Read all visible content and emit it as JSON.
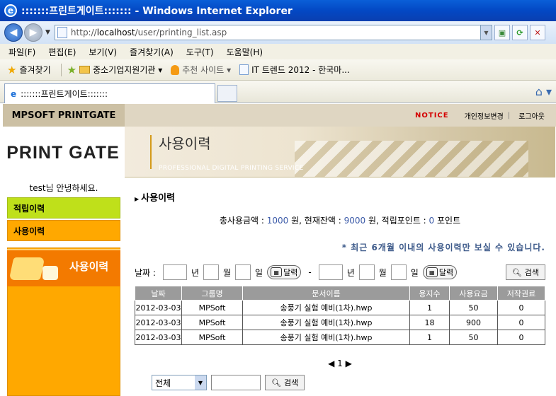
{
  "window": {
    "title": ":::::::프린트게이트::::::: - Windows Internet Explorer"
  },
  "address": {
    "prefix": "http://",
    "host": "localhost",
    "path": "/user/printing_list.asp"
  },
  "menu": [
    "파일(F)",
    "편집(E)",
    "보기(V)",
    "즐겨찾기(A)",
    "도구(T)",
    "도움말(H)"
  ],
  "favorites": {
    "label": "즐겨찾기",
    "items": [
      "중소기업지원기관 ▾",
      "추천 사이트 ▾",
      "IT 트렌드 2012 - 한국마..."
    ]
  },
  "tab": {
    "title": ":::::::프린트게이트:::::::"
  },
  "site": {
    "brand": "MPSOFT PRINTGATE",
    "notice": "NOTICE",
    "links": [
      "개인정보변경",
      "로그아웃"
    ],
    "logo": "PRINT GATE",
    "banner_title": "사용이력",
    "banner_sub": "PROFESSIONAL DIGITAL PRINTING SERVICE",
    "greeting": "test님 안녕하세요.",
    "left_menu": [
      "적립이력",
      "사용이력"
    ],
    "left_box_title": "사용이력"
  },
  "page": {
    "section": "사용이력",
    "summary": {
      "a_label": "총사용금액 : ",
      "a_val": "1000",
      "a_unit": " 원, 현재잔액 : ",
      "b_val": "9000",
      "b_unit": " 원, 적립포인트 : ",
      "c_val": "0",
      "c_unit": " 포인트"
    },
    "notice": "* 최근 6개월 이내의 사용이력만 보실 수 있습니다.",
    "search": {
      "date_label": "날짜 :",
      "year": "년",
      "month": "월",
      "day": "일",
      "cal": "달력",
      "dash": "-",
      "btn": "검색"
    },
    "columns": [
      "날짜",
      "그룹명",
      "문서이름",
      "용지수",
      "사용요금",
      "저작권료"
    ],
    "rows": [
      [
        "2012-03-03",
        "MPSoft",
        "송풍기 실험 예비(1차).hwp",
        "1",
        "50",
        "0"
      ],
      [
        "2012-03-03",
        "MPSoft",
        "송풍기 실험 예비(1차).hwp",
        "18",
        "900",
        "0"
      ],
      [
        "2012-03-03",
        "MPSoft",
        "송풍기 실험 예비(1차).hwp",
        "1",
        "50",
        "0"
      ]
    ],
    "pager": "1",
    "filter": {
      "selected": "전체",
      "btn": "검색"
    }
  }
}
